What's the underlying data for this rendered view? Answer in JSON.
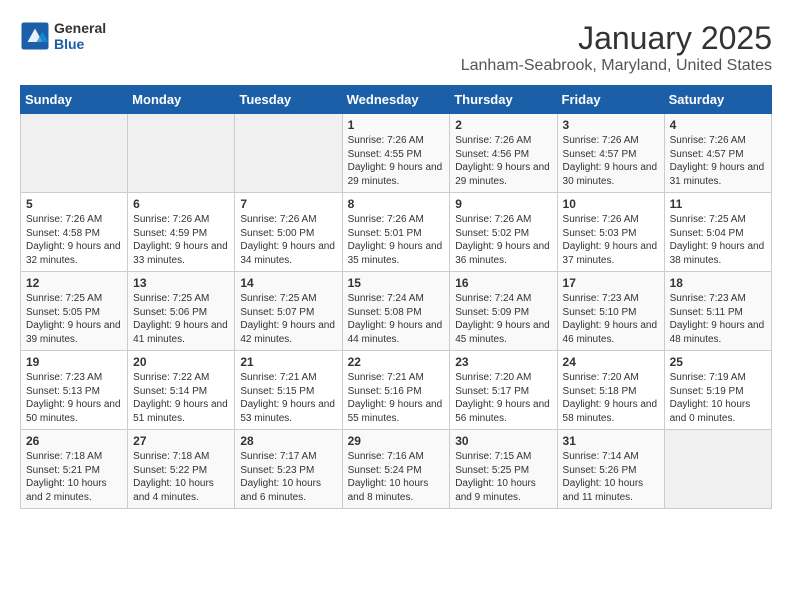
{
  "header": {
    "logo": {
      "general": "General",
      "blue": "Blue"
    },
    "month_title": "January 2025",
    "location": "Lanham-Seabrook, Maryland, United States"
  },
  "days_of_week": [
    "Sunday",
    "Monday",
    "Tuesday",
    "Wednesday",
    "Thursday",
    "Friday",
    "Saturday"
  ],
  "weeks": [
    [
      {
        "day": "",
        "empty": true
      },
      {
        "day": "",
        "empty": true
      },
      {
        "day": "",
        "empty": true
      },
      {
        "day": "1",
        "sunrise": "7:26 AM",
        "sunset": "4:55 PM",
        "daylight": "9 hours and 29 minutes."
      },
      {
        "day": "2",
        "sunrise": "7:26 AM",
        "sunset": "4:56 PM",
        "daylight": "9 hours and 29 minutes."
      },
      {
        "day": "3",
        "sunrise": "7:26 AM",
        "sunset": "4:57 PM",
        "daylight": "9 hours and 30 minutes."
      },
      {
        "day": "4",
        "sunrise": "7:26 AM",
        "sunset": "4:57 PM",
        "daylight": "9 hours and 31 minutes."
      }
    ],
    [
      {
        "day": "5",
        "sunrise": "7:26 AM",
        "sunset": "4:58 PM",
        "daylight": "9 hours and 32 minutes."
      },
      {
        "day": "6",
        "sunrise": "7:26 AM",
        "sunset": "4:59 PM",
        "daylight": "9 hours and 33 minutes."
      },
      {
        "day": "7",
        "sunrise": "7:26 AM",
        "sunset": "5:00 PM",
        "daylight": "9 hours and 34 minutes."
      },
      {
        "day": "8",
        "sunrise": "7:26 AM",
        "sunset": "5:01 PM",
        "daylight": "9 hours and 35 minutes."
      },
      {
        "day": "9",
        "sunrise": "7:26 AM",
        "sunset": "5:02 PM",
        "daylight": "9 hours and 36 minutes."
      },
      {
        "day": "10",
        "sunrise": "7:26 AM",
        "sunset": "5:03 PM",
        "daylight": "9 hours and 37 minutes."
      },
      {
        "day": "11",
        "sunrise": "7:25 AM",
        "sunset": "5:04 PM",
        "daylight": "9 hours and 38 minutes."
      }
    ],
    [
      {
        "day": "12",
        "sunrise": "7:25 AM",
        "sunset": "5:05 PM",
        "daylight": "9 hours and 39 minutes."
      },
      {
        "day": "13",
        "sunrise": "7:25 AM",
        "sunset": "5:06 PM",
        "daylight": "9 hours and 41 minutes."
      },
      {
        "day": "14",
        "sunrise": "7:25 AM",
        "sunset": "5:07 PM",
        "daylight": "9 hours and 42 minutes."
      },
      {
        "day": "15",
        "sunrise": "7:24 AM",
        "sunset": "5:08 PM",
        "daylight": "9 hours and 44 minutes."
      },
      {
        "day": "16",
        "sunrise": "7:24 AM",
        "sunset": "5:09 PM",
        "daylight": "9 hours and 45 minutes."
      },
      {
        "day": "17",
        "sunrise": "7:23 AM",
        "sunset": "5:10 PM",
        "daylight": "9 hours and 46 minutes."
      },
      {
        "day": "18",
        "sunrise": "7:23 AM",
        "sunset": "5:11 PM",
        "daylight": "9 hours and 48 minutes."
      }
    ],
    [
      {
        "day": "19",
        "sunrise": "7:23 AM",
        "sunset": "5:13 PM",
        "daylight": "9 hours and 50 minutes."
      },
      {
        "day": "20",
        "sunrise": "7:22 AM",
        "sunset": "5:14 PM",
        "daylight": "9 hours and 51 minutes."
      },
      {
        "day": "21",
        "sunrise": "7:21 AM",
        "sunset": "5:15 PM",
        "daylight": "9 hours and 53 minutes."
      },
      {
        "day": "22",
        "sunrise": "7:21 AM",
        "sunset": "5:16 PM",
        "daylight": "9 hours and 55 minutes."
      },
      {
        "day": "23",
        "sunrise": "7:20 AM",
        "sunset": "5:17 PM",
        "daylight": "9 hours and 56 minutes."
      },
      {
        "day": "24",
        "sunrise": "7:20 AM",
        "sunset": "5:18 PM",
        "daylight": "9 hours and 58 minutes."
      },
      {
        "day": "25",
        "sunrise": "7:19 AM",
        "sunset": "5:19 PM",
        "daylight": "10 hours and 0 minutes."
      }
    ],
    [
      {
        "day": "26",
        "sunrise": "7:18 AM",
        "sunset": "5:21 PM",
        "daylight": "10 hours and 2 minutes."
      },
      {
        "day": "27",
        "sunrise": "7:18 AM",
        "sunset": "5:22 PM",
        "daylight": "10 hours and 4 minutes."
      },
      {
        "day": "28",
        "sunrise": "7:17 AM",
        "sunset": "5:23 PM",
        "daylight": "10 hours and 6 minutes."
      },
      {
        "day": "29",
        "sunrise": "7:16 AM",
        "sunset": "5:24 PM",
        "daylight": "10 hours and 8 minutes."
      },
      {
        "day": "30",
        "sunrise": "7:15 AM",
        "sunset": "5:25 PM",
        "daylight": "10 hours and 9 minutes."
      },
      {
        "day": "31",
        "sunrise": "7:14 AM",
        "sunset": "5:26 PM",
        "daylight": "10 hours and 11 minutes."
      },
      {
        "day": "",
        "empty": true
      }
    ]
  ],
  "labels": {
    "sunrise": "Sunrise:",
    "sunset": "Sunset:",
    "daylight": "Daylight:"
  }
}
